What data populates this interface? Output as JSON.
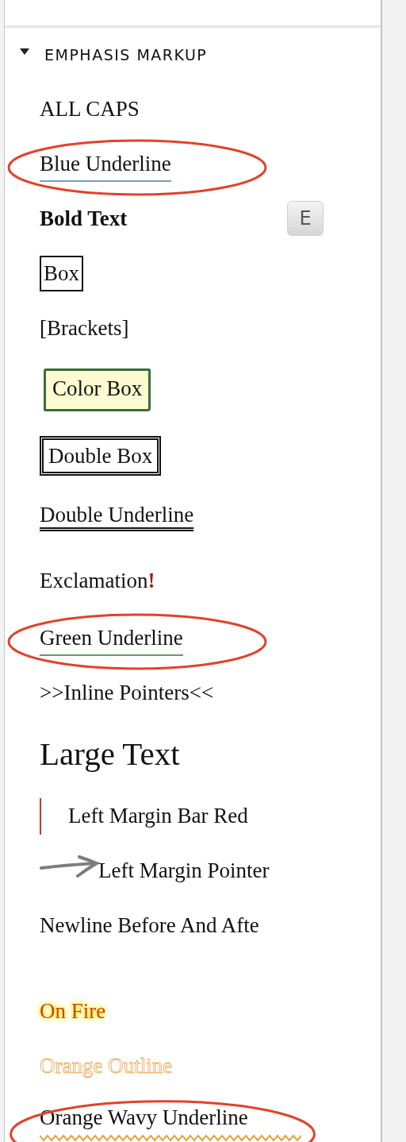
{
  "section": {
    "title": "EMPHASIS MARKUP",
    "expanded": true,
    "items": [
      {
        "kind": "caps",
        "text": "ALL CAPS",
        "circled": false
      },
      {
        "kind": "underline",
        "text": "Blue Underline",
        "color": "#7a9cc6",
        "circled": true
      },
      {
        "kind": "bold",
        "text": "Bold Text",
        "shortcut": "E",
        "circled": false
      },
      {
        "kind": "box",
        "text": "Box",
        "circled": false
      },
      {
        "kind": "plain",
        "text": "[Brackets]",
        "circled": false
      },
      {
        "kind": "colorbox",
        "text": "Color Box",
        "circled": false
      },
      {
        "kind": "doublebox",
        "text": "Double Box",
        "circled": false
      },
      {
        "kind": "doubleunderline",
        "text": "Double Underline",
        "circled": false
      },
      {
        "kind": "exclamation",
        "text": "Exclamation",
        "mark": "!",
        "circled": false
      },
      {
        "kind": "underline",
        "text": "Green Underline",
        "color": "#5f9f57",
        "circled": true
      },
      {
        "kind": "plain",
        "text": ">>Inline Pointers<<",
        "circled": false
      },
      {
        "kind": "large",
        "text": "Large Text",
        "circled": false
      },
      {
        "kind": "marginbar",
        "text": "Left Margin Bar Red",
        "color": "#cc3a30",
        "circled": false
      },
      {
        "kind": "pointer",
        "text": "Left Margin Pointer",
        "circled": false
      },
      {
        "kind": "newline",
        "text": "Newline Before And Afte",
        "circled": false
      },
      {
        "kind": "fire",
        "text": "On Fire",
        "circled": false
      },
      {
        "kind": "outline",
        "text": "Orange Outline",
        "circled": false
      },
      {
        "kind": "wavy",
        "text": "Orange Wavy Underline",
        "color": "#e6a23c",
        "circled": true
      }
    ]
  }
}
